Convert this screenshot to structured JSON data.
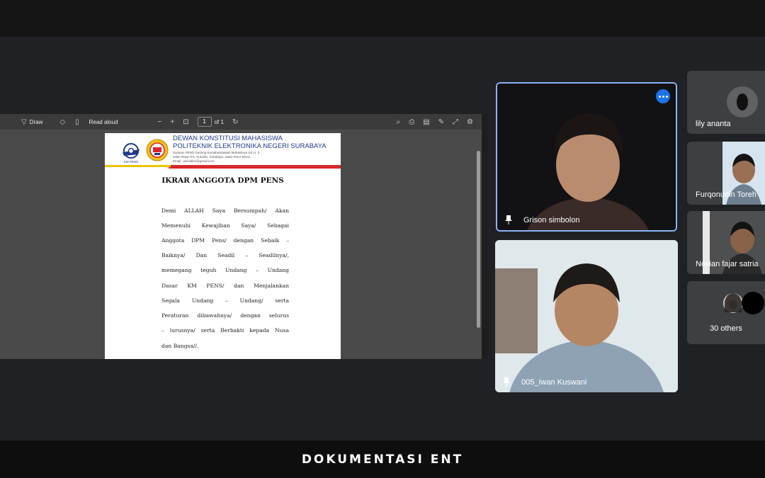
{
  "shared_screen": {
    "toolbar": {
      "draw_label": "Draw",
      "read_aloud_label": "Read aloud",
      "page_current": "1",
      "page_total": "of 1"
    },
    "document": {
      "org_line1": "DEWAN KONSTITUSI MAHASISWA",
      "org_line2": "POLITEKNIK ELEKTRONIKA NEGERI SURABAYA",
      "address1": "Kampus PENS Gedung Kemahasiswaan Mahasiswa D3 Lt. 3",
      "address2": "Jalan Raya ITS, Sukolilo, Surabaya, Jawa Timur 60111",
      "email": "Email : pensdkm@gmail.com",
      "logo_text": "KM PENS",
      "title": "IKRAR ANGGOTA DPM PENS",
      "lines": [
        "Demi ALLAH Saya Bersumpah/ Akan",
        "Memenuhi Kewajiban Saya/ Sebagai",
        "Anggota DPM Pens/ dengan Sebaik –",
        "Baiknya/ Dan Seadil – Seadilnya/,",
        "memegang teguh Undang – Undang",
        "Dasar KM PENS/ dan Menjalankan",
        "Segala Undang – Undang/ serta",
        "Peraturan dibawahnya/ dengan selurus",
        "– lurusnya/ serta Berbakti kepada Nusa",
        "dan Bangsa//."
      ]
    }
  },
  "participants": {
    "main": [
      {
        "name": "Grison simbolon"
      },
      {
        "name": "005_Iwan Kuswani"
      }
    ],
    "side": [
      {
        "name": "lily ananta"
      },
      {
        "name": "Furqonudin Toreh"
      },
      {
        "name": "Novian fajar satria"
      }
    ],
    "others_label": "30 others"
  },
  "colors": {
    "accent_border": "#8ab4f8",
    "menu_button": "#1a73e8"
  },
  "caption": "DOKUMENTASI ENT"
}
